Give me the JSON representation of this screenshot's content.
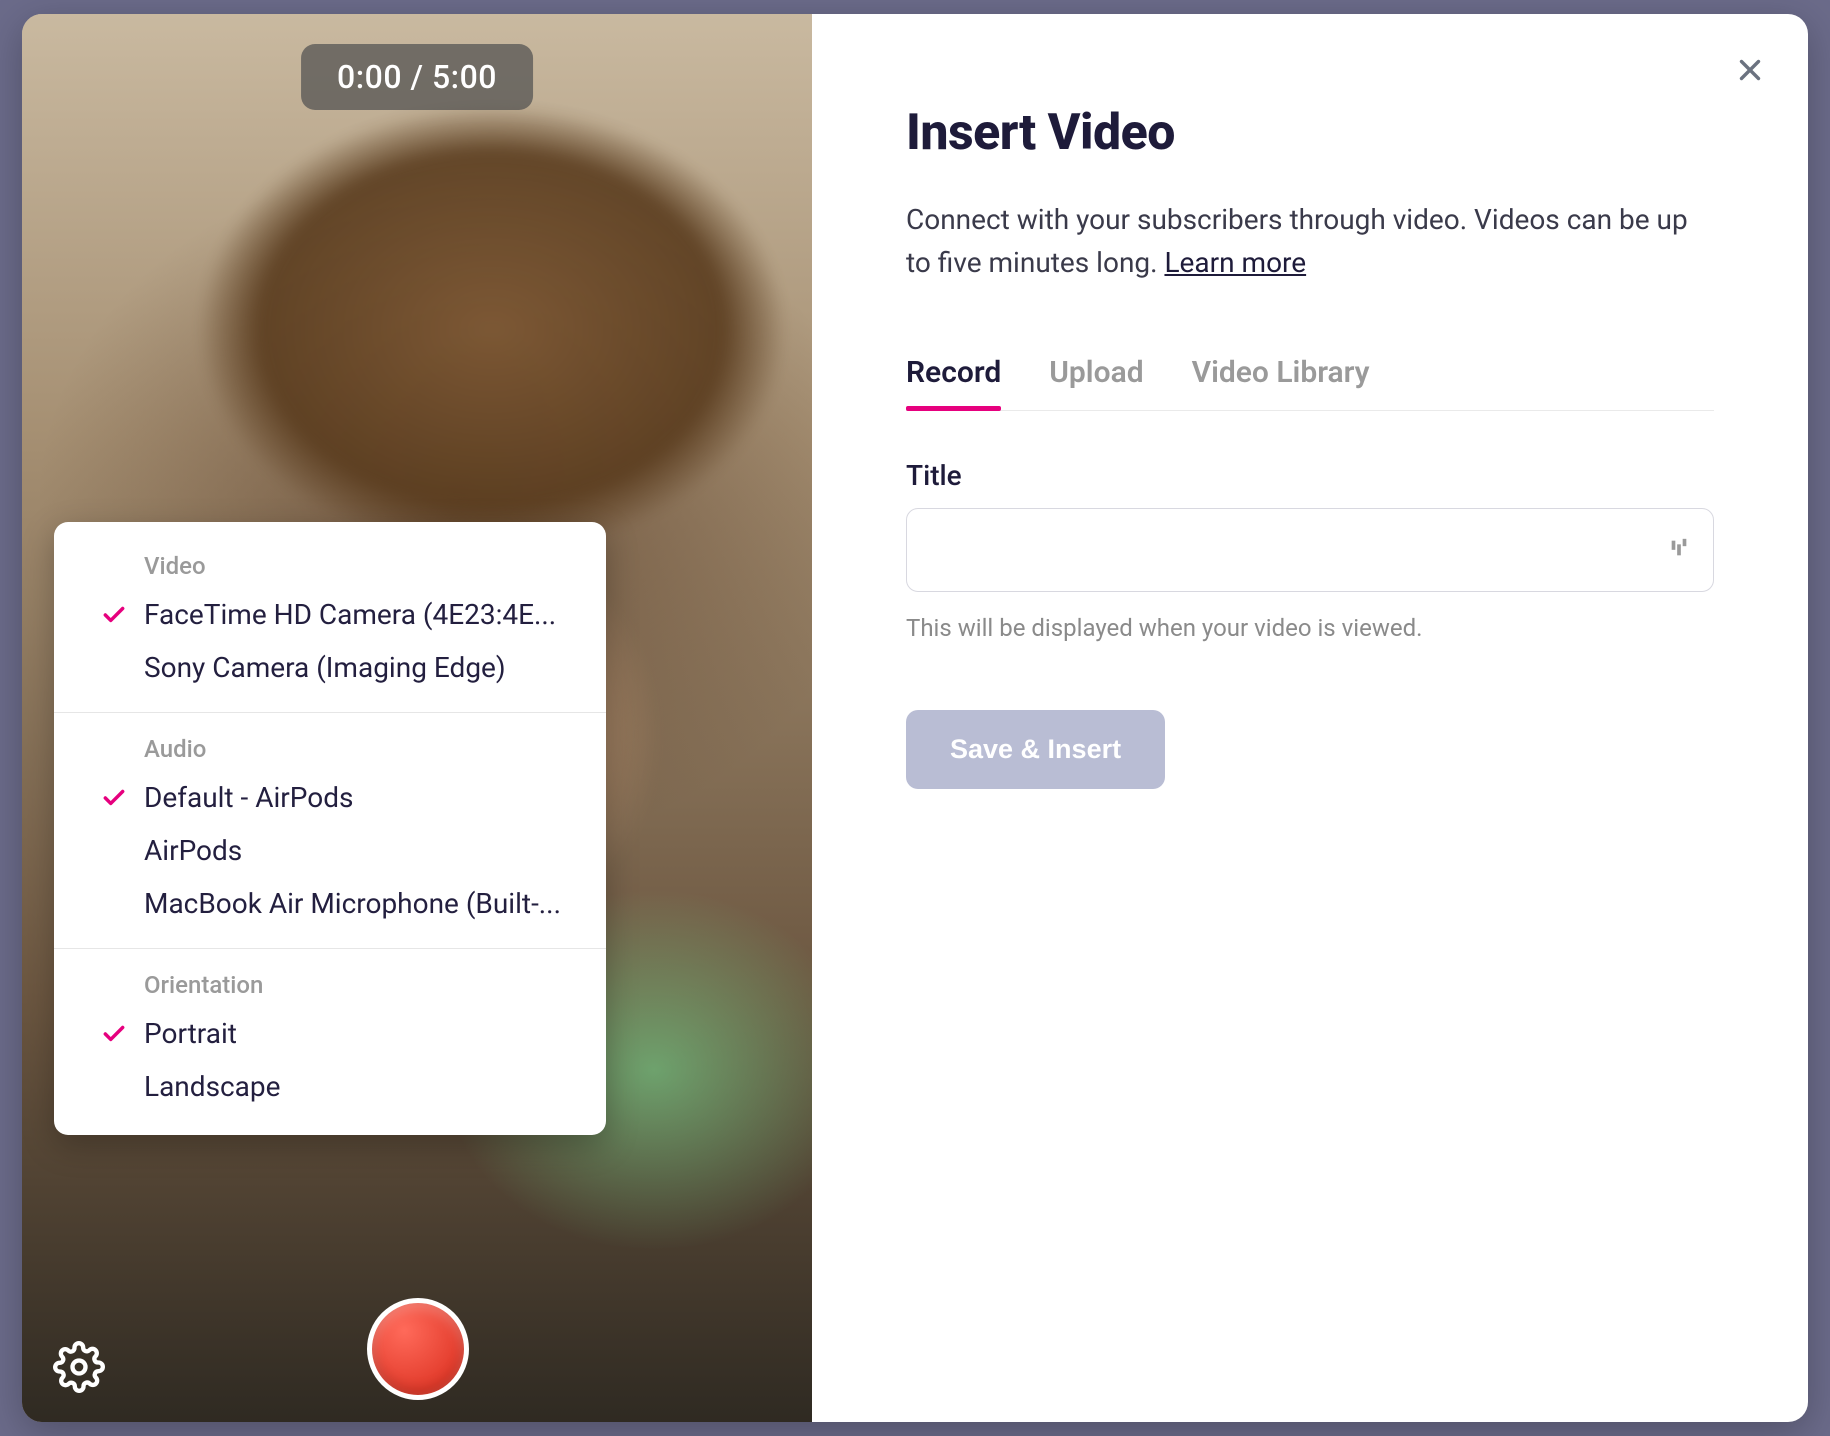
{
  "timer": "0:00 / 5:00",
  "settings": {
    "video": {
      "heading": "Video",
      "items": [
        {
          "label": "FaceTime HD Camera (4E23:4E...",
          "selected": true
        },
        {
          "label": "Sony Camera (Imaging Edge)",
          "selected": false
        }
      ]
    },
    "audio": {
      "heading": "Audio",
      "items": [
        {
          "label": "Default - AirPods",
          "selected": true
        },
        {
          "label": "AirPods",
          "selected": false
        },
        {
          "label": "MacBook Air Microphone (Built-...",
          "selected": false
        }
      ]
    },
    "orientation": {
      "heading": "Orientation",
      "items": [
        {
          "label": "Portrait",
          "selected": true
        },
        {
          "label": "Landscape",
          "selected": false
        }
      ]
    }
  },
  "modal": {
    "title": "Insert Video",
    "description_pre": "Connect with your subscribers through video. Videos can be up to five minutes long. ",
    "learn_more": "Learn more",
    "tabs": [
      {
        "label": "Record",
        "active": true
      },
      {
        "label": "Upload",
        "active": false
      },
      {
        "label": "Video Library",
        "active": false
      }
    ],
    "title_field": {
      "label": "Title",
      "value": "",
      "helper": "This will be displayed when your video is viewed."
    },
    "save_button": "Save & Insert"
  }
}
